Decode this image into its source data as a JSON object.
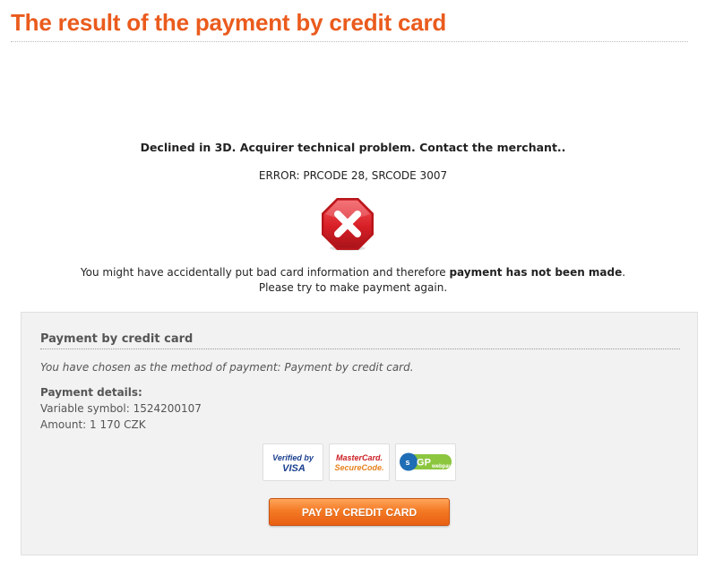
{
  "page": {
    "title": "The result of the payment by credit card"
  },
  "result": {
    "decline_message": "Declined in 3D. Acquirer technical problem. Contact the merchant..",
    "error_code": "ERROR: PRCODE 28, SRCODE 3007",
    "status_icon": "error-stop-icon",
    "hint_prefix": "You might have accidentally put bad card information and therefore ",
    "hint_bold": "payment has not been made",
    "hint_suffix": ".",
    "hint_line2": "Please try to make payment again."
  },
  "payment_box": {
    "title": "Payment by credit card",
    "method_text": "You have chosen as the method of payment: Payment by credit card.",
    "details_title": "Payment details:",
    "variable_symbol": "Variable symbol: 1524200107",
    "amount": "Amount: 1 170 CZK",
    "logos": {
      "visa_line1": "Verified by",
      "visa_line2": "VISA",
      "mastercard_line1": "MasterCard.",
      "mastercard_line2": "SecureCode.",
      "gp_main": "GP",
      "gp_sub": "webpay"
    },
    "pay_button_label": "PAY BY CREDIT CARD"
  },
  "colors": {
    "title": "#ea5b1d",
    "button": "#f47a25",
    "error_icon": "#d3202a"
  }
}
